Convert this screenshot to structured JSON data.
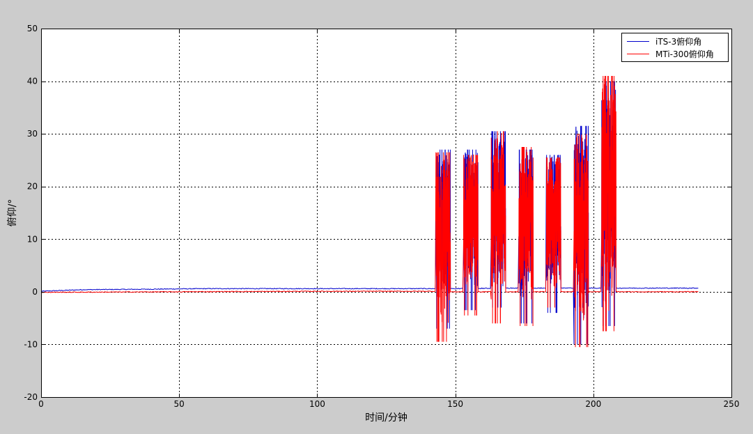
{
  "window": {
    "background": "#cccccc"
  },
  "chart_data": {
    "type": "line",
    "title": "",
    "xlabel": "时间/分钟",
    "ylabel": "俯仰/°",
    "xlim": [
      0,
      250
    ],
    "ylim": [
      -20,
      50
    ],
    "x_ticks": [
      0,
      50,
      100,
      150,
      200,
      250
    ],
    "y_ticks": [
      -20,
      -10,
      0,
      10,
      20,
      30,
      40,
      50
    ],
    "grid": true,
    "grid_style": "dotted",
    "legend_position": "top-right",
    "series": [
      {
        "name": "iTS-3俯仰角",
        "color": "#0000cc",
        "baseline": [
          [
            0,
            0.1
          ],
          [
            15,
            0.4
          ],
          [
            40,
            0.5
          ],
          [
            60,
            0.6
          ],
          [
            100,
            0.6
          ],
          [
            142.7,
            0.6
          ],
          [
            150,
            0.6
          ],
          [
            170,
            0.7
          ],
          [
            200,
            0.7
          ],
          [
            238,
            0.7
          ]
        ],
        "bursts": [
          {
            "x": [
              142.8,
              148.0
            ],
            "min": -7.0,
            "max": 27.0
          },
          {
            "x": [
              152.8,
              158.0
            ],
            "min": -3.5,
            "max": 27.0
          },
          {
            "x": [
              163.0,
              168.0
            ],
            "min": -3.0,
            "max": 30.5
          },
          {
            "x": [
              173.0,
              178.0
            ],
            "min": -6.0,
            "max": 27.0
          },
          {
            "x": [
              183.0,
              188.0
            ],
            "min": -4.0,
            "max": 26.0
          },
          {
            "x": [
              193.0,
              198.0
            ],
            "min": -10.0,
            "max": 31.5
          },
          {
            "x": [
              203.0,
              208.0
            ],
            "min": -6.5,
            "max": 40.0
          }
        ]
      },
      {
        "name": "MTi-300俯仰角",
        "color": "#ff0000",
        "baseline": [
          [
            0,
            -0.1
          ],
          [
            50,
            0.0
          ],
          [
            100,
            0.1
          ],
          [
            142.7,
            0.1
          ],
          [
            150,
            0.0
          ],
          [
            200,
            0.0
          ],
          [
            238,
            0.0
          ]
        ],
        "bursts": [
          {
            "x": [
              142.8,
              148.0
            ],
            "min": -9.5,
            "max": 26.5
          },
          {
            "x": [
              152.8,
              158.0
            ],
            "min": -4.5,
            "max": 26.0
          },
          {
            "x": [
              163.0,
              168.0
            ],
            "min": -6.0,
            "max": 30.5
          },
          {
            "x": [
              173.0,
              178.0
            ],
            "min": -6.5,
            "max": 27.5
          },
          {
            "x": [
              183.0,
              188.0
            ],
            "min": -3.0,
            "max": 25.5
          },
          {
            "x": [
              193.0,
              198.0
            ],
            "min": -10.5,
            "max": 30.0
          },
          {
            "x": [
              203.0,
              208.0
            ],
            "min": -7.5,
            "max": 41.0
          }
        ]
      }
    ]
  }
}
